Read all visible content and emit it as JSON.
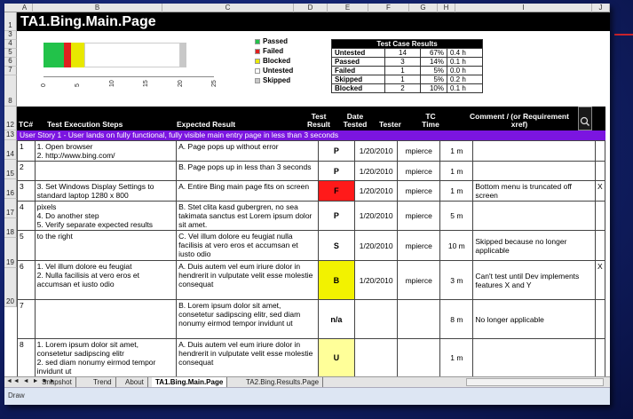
{
  "sheet": {
    "title": "TA1.Bing.Main.Page",
    "columns": [
      "A",
      "B",
      "C",
      "D",
      "E",
      "F",
      "G",
      "H",
      "I",
      "J"
    ],
    "row_numbers": [
      "1",
      "3",
      "4",
      "5",
      "6",
      "7",
      "8",
      "12",
      "13",
      "14",
      "15",
      "16",
      "17",
      "18",
      "19",
      "20"
    ]
  },
  "chart": {
    "ticks": [
      "0",
      "5",
      "10",
      "15",
      "20",
      "25"
    ],
    "legend": [
      {
        "label": "Passed",
        "color": "#22c24a"
      },
      {
        "label": "Failed",
        "color": "#e0201e"
      },
      {
        "label": "Blocked",
        "color": "#e8e800"
      },
      {
        "label": "Untested",
        "color": "#ffffff"
      },
      {
        "label": "Skipped",
        "color": "#c8c8c8"
      }
    ]
  },
  "chart_data": {
    "type": "bar",
    "orientation": "horizontal-stacked",
    "categories": [
      "Test Cases"
    ],
    "series": [
      {
        "name": "Passed",
        "values": [
          3
        ]
      },
      {
        "name": "Failed",
        "values": [
          1
        ]
      },
      {
        "name": "Blocked",
        "values": [
          2
        ]
      },
      {
        "name": "Untested",
        "values": [
          14
        ]
      },
      {
        "name": "Skipped",
        "values": [
          1
        ]
      }
    ],
    "xlim": [
      0,
      25
    ],
    "ticks": [
      0,
      5,
      10,
      15,
      20,
      25
    ]
  },
  "summary": {
    "header": "Test Case Results",
    "rows": [
      {
        "label": "Untested",
        "count": "14",
        "pct": "67%",
        "time": "0.4 h"
      },
      {
        "label": "Passed",
        "count": "3",
        "pct": "14%",
        "time": "0.1 h"
      },
      {
        "label": "Failed",
        "count": "1",
        "pct": "5%",
        "time": "0.0 h"
      },
      {
        "label": "Skipped",
        "count": "1",
        "pct": "5%",
        "time": "0.2 h"
      },
      {
        "label": "Blocked",
        "count": "2",
        "pct": "10%",
        "time": "0.1 h"
      }
    ]
  },
  "headers": {
    "tc": "TC#",
    "steps": "Test Execution Steps",
    "expected": "Expected Result",
    "result": "Test Result",
    "date": "Date Tested",
    "tester": "Tester",
    "time": "TC Time",
    "comment": "Comment / (or Requirement xref)"
  },
  "story": "User Story 1 - User lands on fully functional, fully visible main entry page in less than 3 seconds",
  "rows": [
    {
      "tc": "1",
      "steps": "1. Open browser\n2. http://www.bing.com/",
      "expected": "A. Page pops up without error",
      "result": "P",
      "date": "1/20/2010",
      "tester": "mpierce",
      "time": "1 m",
      "comment": "",
      "x": ""
    },
    {
      "tc": "2",
      "steps": "",
      "expected": "B. Page pops up in less than 3 seconds",
      "result": "P",
      "date": "1/20/2010",
      "tester": "mpierce",
      "time": "1 m",
      "comment": "",
      "x": ""
    },
    {
      "tc": "3",
      "steps": "3. Set Windows Display Settings to standard laptop 1280 x 800",
      "expected": "A. Entire Bing main page fits on screen",
      "result": "F",
      "date": "1/20/2010",
      "tester": "mpierce",
      "time": "1 m",
      "comment": "Bottom menu is truncated off screen",
      "x": "X"
    },
    {
      "tc": "4",
      "steps": "pixels\n4. Do another step\n5. Verify separate expected results",
      "expected": "B. Stet clita kasd gubergren, no sea takimata sanctus est Lorem ipsum dolor sit amet.",
      "result": "P",
      "date": "1/20/2010",
      "tester": "mpierce",
      "time": "5 m",
      "comment": "",
      "x": ""
    },
    {
      "tc": "5",
      "steps": "to the right",
      "expected": "C. Vel illum dolore eu feugiat nulla facilisis at vero eros et accumsan et iusto odio",
      "result": "S",
      "date": "1/20/2010",
      "tester": "mpierce",
      "time": "10 m",
      "comment": "Skipped because no longer applicable",
      "x": ""
    },
    {
      "tc": "6",
      "steps": "1. Vel illum dolore eu feugiat\n2. Nulla facilisis at vero eros et accumsan et iusto odio",
      "expected": "A. Duis autem vel eum iriure dolor in hendrerit in vulputate velit esse molestie consequat",
      "result": "B",
      "date": "1/20/2010",
      "tester": "mpierce",
      "time": "3 m",
      "comment": "Can't test until Dev implements features X and Y",
      "x": "X"
    },
    {
      "tc": "7",
      "steps": "",
      "expected": "B. Lorem ipsum dolor sit amet, consetetur sadipscing elitr, sed diam nonumy eirmod tempor invidunt ut",
      "result": "n/a",
      "date": "",
      "tester": "",
      "time": "8 m",
      "comment": "No longer applicable",
      "x": ""
    },
    {
      "tc": "8",
      "steps": "1. Lorem ipsum dolor sit amet, consetetur sadipscing elitr\n2. sed diam nonumy eirmod tempor invidunt ut",
      "expected": "A. Duis autem vel eum iriure dolor in hendrerit in vulputate velit esse molestie consequat",
      "result": "U",
      "date": "",
      "tester": "",
      "time": "1 m",
      "comment": "",
      "x": ""
    }
  ],
  "result_colors": {
    "F": "#ff1a1a",
    "B": "#f2f200",
    "U": "#ffff99"
  },
  "tabs": [
    "Snapshot",
    "Trend",
    "About",
    "TA1.Bing.Main.Page",
    "TA2.Bing.Results.Page"
  ],
  "active_tab": "TA1.Bing.Main.Page",
  "tab_nav": "◄◄ ◄ ► ►►",
  "drawbar": "Draw"
}
